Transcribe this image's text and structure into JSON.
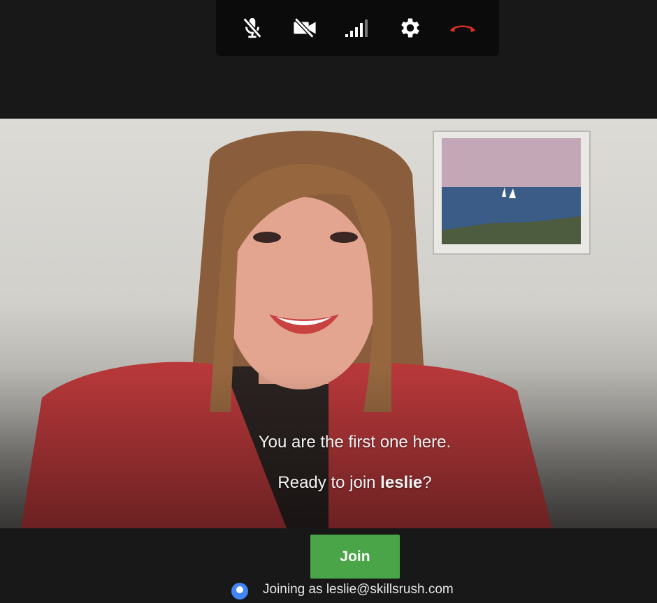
{
  "toolbar": {
    "icons": [
      "mic-off-icon",
      "camera-off-icon",
      "signal-bars-icon",
      "gear-icon",
      "hang-up-icon"
    ],
    "colors": {
      "icon": "#ffffff",
      "hangup": "#d93025",
      "background": "#0b0b0b"
    }
  },
  "video": {
    "message_line1": "You are the first one here.",
    "message_line2_prefix": "Ready to join ",
    "meeting_name": "leslie",
    "message_line2_suffix": "?"
  },
  "join": {
    "label": "Join",
    "color": "#4aa548"
  },
  "account": {
    "text": "Joining as leslie@skillsrush.com",
    "icon": "account-icon"
  }
}
